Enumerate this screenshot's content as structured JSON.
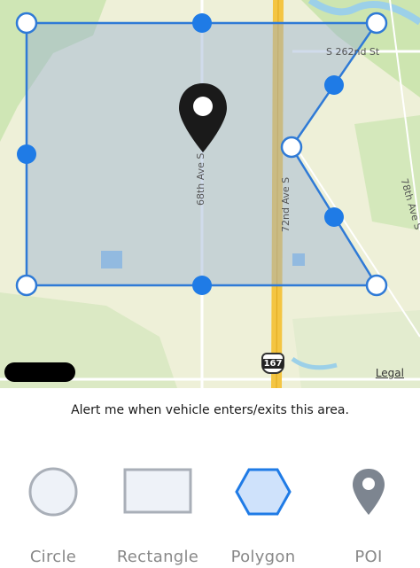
{
  "map": {
    "road_labels": {
      "s262nd": "S 262nd St",
      "ave68": "68th Ave S",
      "ave72": "72nd Ave S",
      "ave78": "78th Ave S"
    },
    "highway_number": "167",
    "legal": "Legal",
    "colors": {
      "fence_stroke": "#2f7ad6",
      "fence_fill": "rgba(150,175,210,0.45)",
      "handle_blue": "#1f7be6",
      "pin": "#1a1a1a"
    }
  },
  "prompt": "Alert me when vehicle enters/exits this area.",
  "shape_tabs": [
    {
      "label": "Circle",
      "icon": "circle-icon",
      "selected": false
    },
    {
      "label": "Rectangle",
      "icon": "rectangle-icon",
      "selected": false
    },
    {
      "label": "Polygon",
      "icon": "polygon-icon",
      "selected": true
    },
    {
      "label": "POI",
      "icon": "poi-pin-icon",
      "selected": false
    }
  ]
}
